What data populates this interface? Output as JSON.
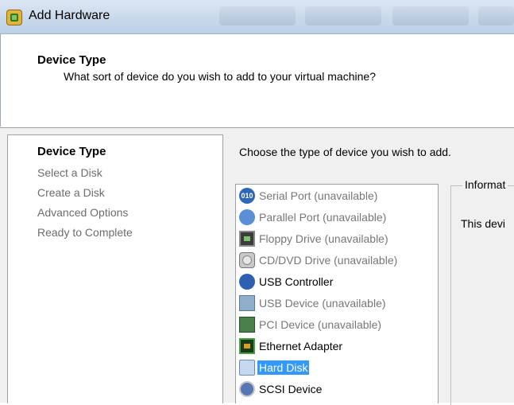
{
  "window": {
    "title": "Add Hardware"
  },
  "header": {
    "title": "Device Type",
    "subtitle": "What sort of device do you wish to add to your virtual machine?"
  },
  "nav": {
    "items": [
      {
        "label": "Device Type",
        "active": true
      },
      {
        "label": "Select a Disk",
        "active": false
      },
      {
        "label": "Create a Disk",
        "active": false
      },
      {
        "label": "Advanced Options",
        "active": false
      },
      {
        "label": "Ready to Complete",
        "active": false
      }
    ]
  },
  "main": {
    "prompt": "Choose the type of device you wish to add.",
    "devices": [
      {
        "label": "Serial Port (unavailable)",
        "icon": "serial-port-icon",
        "enabled": false
      },
      {
        "label": "Parallel Port (unavailable)",
        "icon": "parallel-port-icon",
        "enabled": false
      },
      {
        "label": "Floppy Drive (unavailable)",
        "icon": "floppy-drive-icon",
        "enabled": false
      },
      {
        "label": "CD/DVD Drive (unavailable)",
        "icon": "cd-dvd-drive-icon",
        "enabled": false
      },
      {
        "label": "USB Controller",
        "icon": "usb-controller-icon",
        "enabled": true
      },
      {
        "label": "USB Device (unavailable)",
        "icon": "usb-device-icon",
        "enabled": false
      },
      {
        "label": "PCI Device (unavailable)",
        "icon": "pci-device-icon",
        "enabled": false
      },
      {
        "label": "Ethernet Adapter",
        "icon": "ethernet-adapter-icon",
        "enabled": true
      },
      {
        "label": "Hard Disk",
        "icon": "hard-disk-icon",
        "enabled": true,
        "selected": true
      },
      {
        "label": "SCSI Device",
        "icon": "scsi-device-icon",
        "enabled": true
      }
    ],
    "serial_icon_text": "010",
    "info_legend": "Informat",
    "info_text": "This devi"
  },
  "colors": {
    "selection": "#3399ff",
    "disabled_text": "#777777"
  }
}
